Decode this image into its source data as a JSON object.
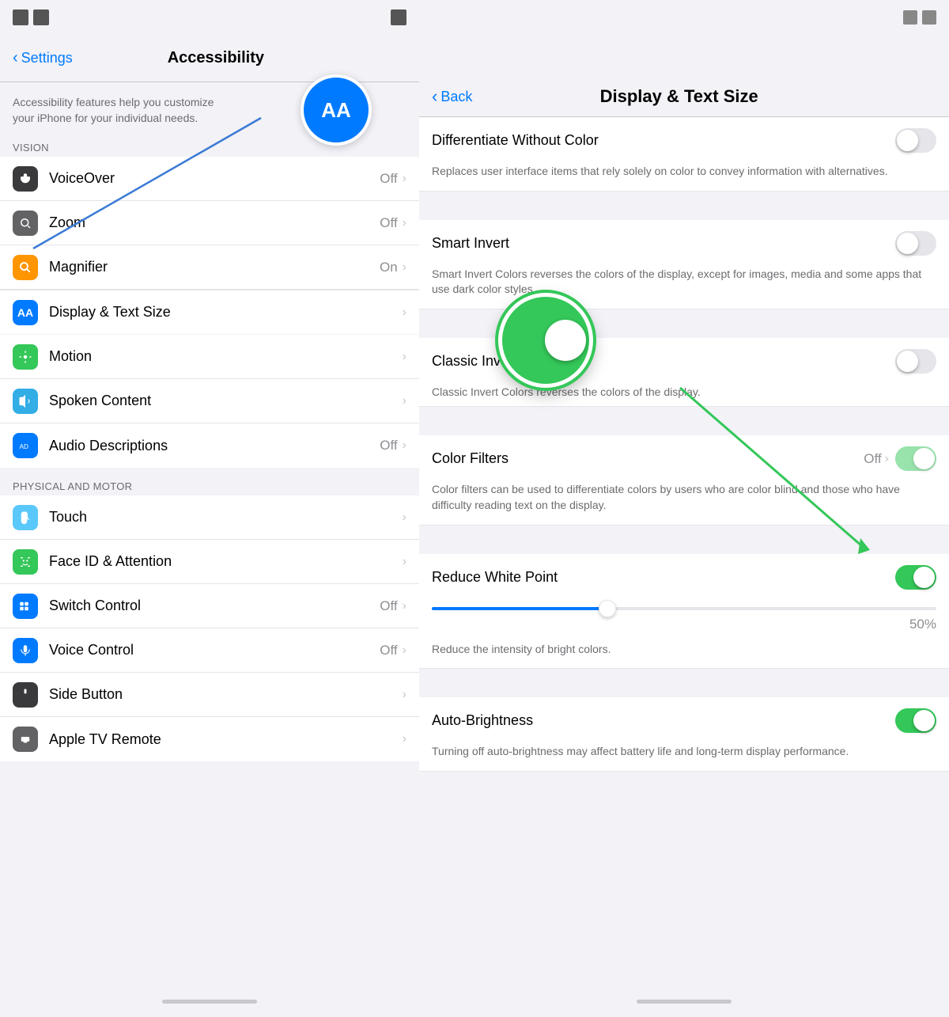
{
  "left": {
    "nav": {
      "back_label": "Settings",
      "title": "Accessibility"
    },
    "description": "Accessibility features help you customize your iPhone for your individual needs.",
    "aa_label": "AA",
    "sections": {
      "vision_label": "VISION",
      "vision_items": [
        {
          "id": "voiceover",
          "label": "VoiceOver",
          "value": "Off",
          "icon_color": "dark",
          "icon_symbol": "speaker"
        },
        {
          "id": "zoom",
          "label": "Zoom",
          "value": "Off",
          "icon_color": "gray",
          "icon_symbol": "zoom"
        },
        {
          "id": "magnifier",
          "label": "Magnifier",
          "value": "On",
          "icon_color": "orange",
          "icon_symbol": "magnifier"
        },
        {
          "id": "display-text-size",
          "label": "Display & Text Size",
          "value": "",
          "icon_color": "blue",
          "icon_symbol": "AA",
          "highlighted": true
        }
      ],
      "physical_label": "PHYSICAL AND MOTOR",
      "physical_items": [
        {
          "id": "motion",
          "label": "Motion",
          "value": "",
          "icon_color": "green",
          "icon_symbol": "motion"
        },
        {
          "id": "spoken-content",
          "label": "Spoken Content",
          "value": "",
          "icon_color": "teal",
          "icon_symbol": "speech"
        },
        {
          "id": "audio-descriptions",
          "label": "Audio Descriptions",
          "value": "Off",
          "icon_color": "blue2",
          "icon_symbol": "audio"
        }
      ],
      "physical_and_motor_label": "PHYSICAL AND MOTOR",
      "motor_items": [
        {
          "id": "touch",
          "label": "Touch",
          "value": "",
          "icon_color": "blue3",
          "icon_symbol": "touch"
        },
        {
          "id": "face-id",
          "label": "Face ID & Attention",
          "value": "",
          "icon_color": "green2",
          "icon_symbol": "faceid"
        },
        {
          "id": "switch-control",
          "label": "Switch Control",
          "value": "Off",
          "icon_color": "blue4",
          "icon_symbol": "switch"
        },
        {
          "id": "voice-control",
          "label": "Voice Control",
          "value": "Off",
          "icon_color": "blue5",
          "icon_symbol": "voice"
        },
        {
          "id": "side-button",
          "label": "Side Button",
          "value": "",
          "icon_color": "dark2",
          "icon_symbol": "side"
        },
        {
          "id": "apple-tv",
          "label": "Apple TV Remote",
          "value": "",
          "icon_color": "gray2",
          "icon_symbol": "tv"
        }
      ]
    }
  },
  "right": {
    "nav": {
      "back_label": "Back",
      "title": "Display & Text Size"
    },
    "items": [
      {
        "id": "differentiate-without-color",
        "label": "Differentiate Without Color",
        "desc": "Replaces user interface items that rely solely on color to convey information with alternatives.",
        "toggle": "off"
      },
      {
        "id": "smart-invert",
        "label": "Smart Invert",
        "desc": "Smart Invert Colors reverses the colors of the display, except for images, media and some apps that use dark color styles.",
        "toggle": "off"
      },
      {
        "id": "classic-invert",
        "label": "Classic Invert",
        "desc": "Classic Invert Colors reverses the colors of the display.",
        "toggle": "off"
      },
      {
        "id": "color-filters",
        "label": "Color Filters",
        "value": "Off",
        "toggle": "on",
        "has_chevron": true
      },
      {
        "id": "color-filters-desc",
        "desc": "Color filters can be used to differentiate colors by users who are color blind and those who have difficulty reading text on the display.",
        "toggle": null
      }
    ],
    "reduce_white_point": {
      "label": "Reduce White Point",
      "toggle": "on",
      "slider_value": "50%",
      "desc": "Reduce the intensity of bright colors."
    },
    "auto_brightness": {
      "label": "Auto-Brightness",
      "toggle": "on",
      "desc": "Turning off auto-brightness may affect battery life and long-term display performance."
    }
  }
}
